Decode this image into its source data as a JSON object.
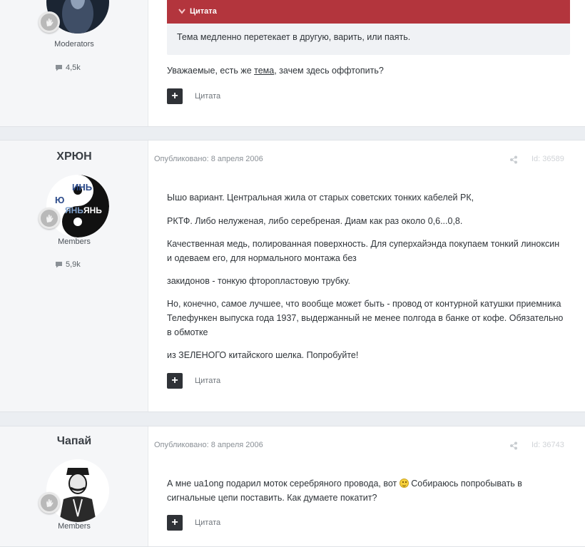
{
  "post1": {
    "author_group": "Moderators",
    "post_count": "4,5k",
    "quote_box": {
      "header": "Цитата",
      "text": "Тема медленно перетекает в другую, варить, или паять."
    },
    "body_prefix": "Уважаемые, есть же ",
    "body_link": "тема",
    "body_suffix": ", зачем здесь оффтопить?",
    "quote_label": "Цитата",
    "quote_btn": "+"
  },
  "post2": {
    "author_name": "ХРЮН",
    "avatar_texts": [
      "ИНЬ",
      "Ю",
      "ЯНЬ",
      "ЯНЬ"
    ],
    "author_group": "Members",
    "post_count": "5,9k",
    "meta": "Опубликовано: 8 апреля 2006",
    "post_id": "Id: 36589",
    "paragraphs": [
      "Ышо вариант. Центральная жила от старых советских тонких кабелей РК,",
      "РКТФ. Либо нелуженая, либо серебреная. Диам как раз около 0,6...0,8.",
      "Качественная медь, полированная поверхность. Для суперхайэнда покупаем тонкий линоксин и одеваем его, для нормального монтажа без",
      "закидонов - тонкую фторопластовую трубку.",
      "Но, конечно, самое лучшее, что вообще может быть - провод от контурной катушки приемника Телефункен выпуска года 1937, выдержанный не менее полгода в банке от кофе. Обязательно в обмотке",
      "из ЗЕЛЕНОГО китайского шелка. Попробуйте!"
    ],
    "quote_label": "Цитата",
    "quote_btn": "+"
  },
  "post3": {
    "author_name": "Чапай",
    "author_group": "Members",
    "meta": "Опубликовано: 8 апреля 2006",
    "post_id": "Id: 36743",
    "body_part1": "А мне ua1ong подарил моток серебряного провода, вот ",
    "body_part2": " Собираюсь попробывать в сигнальные цепи поставить. Как думаете покатит?",
    "quote_label": "Цитата",
    "quote_btn": "+"
  },
  "colors": {
    "quote_header_bg": "#b3353d",
    "quote_body_bg": "#f0f2f5",
    "page_bg": "#ebeef2",
    "author_bg": "#f5f6f8"
  },
  "icons": [
    "comment-icon",
    "share-icon",
    "chevron-down-icon",
    "hand-icon",
    "plus-icon",
    "smiley-icon"
  ]
}
